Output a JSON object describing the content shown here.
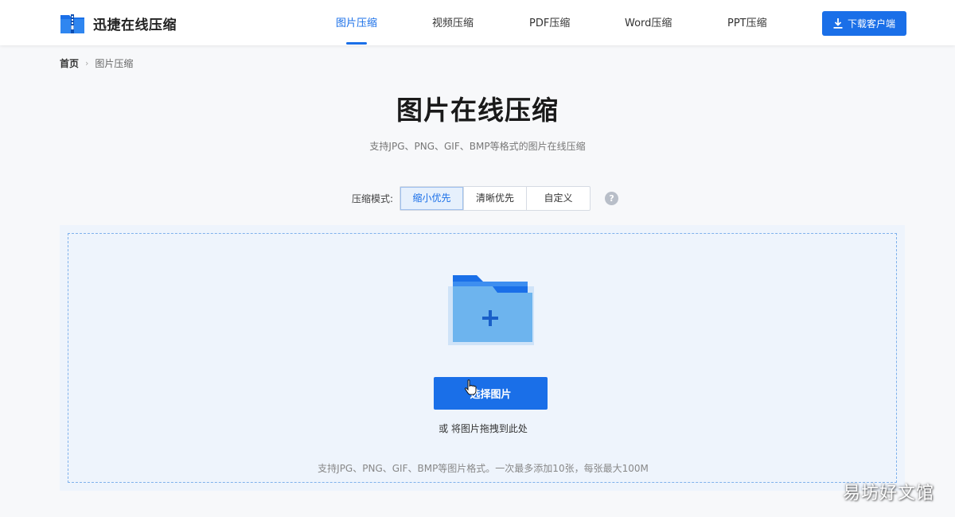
{
  "app": {
    "name": "迅捷在线压缩"
  },
  "nav": {
    "items": [
      {
        "label": "图片压缩",
        "active": true
      },
      {
        "label": "视频压缩",
        "active": false
      },
      {
        "label": "PDF压缩",
        "active": false
      },
      {
        "label": "Word压缩",
        "active": false
      },
      {
        "label": "PPT压缩",
        "active": false
      }
    ],
    "download_label": "下载客户端"
  },
  "breadcrumb": {
    "home": "首页",
    "current": "图片压缩"
  },
  "main": {
    "title": "图片在线压缩",
    "subtitle": "支持JPG、PNG、GIF、BMP等格式的图片在线压缩"
  },
  "mode": {
    "label": "压缩模式:",
    "options": [
      "缩小优先",
      "清晰优先",
      "自定义"
    ],
    "selected": "缩小优先",
    "help": "?"
  },
  "upload": {
    "button_label": "选择图片",
    "drag_hint": "或 将图片拖拽到此处",
    "format_note": "支持JPG、PNG、GIF、BMP等图片格式。一次最多添加10张，每张最大100M"
  },
  "watermark": "易坊好文馆",
  "colors": {
    "accent": "#1a6fe8",
    "upload_bg": "#eef4fc",
    "dashed_border": "#7fb1ec"
  }
}
